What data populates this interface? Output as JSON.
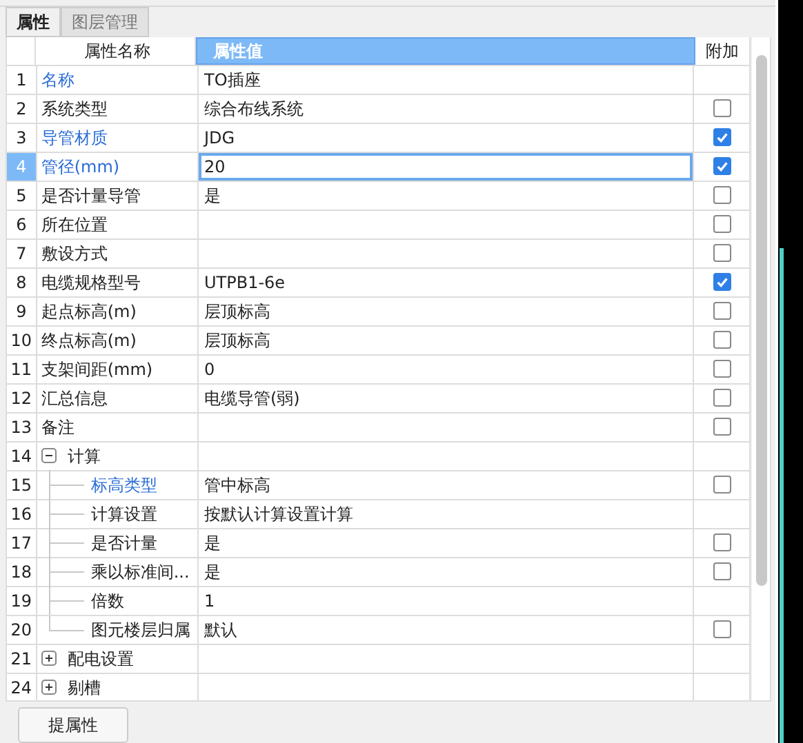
{
  "tabs": [
    {
      "label": "属性",
      "selected": true
    },
    {
      "label": "图层管理",
      "selected": false
    }
  ],
  "columns": {
    "name": "属性名称",
    "value": "属性值",
    "extra": "附加"
  },
  "rows": [
    {
      "num": "1",
      "name": "名称",
      "value": "TO插座",
      "emphasized": true,
      "selected": false
    },
    {
      "num": "2",
      "name": "系统类型",
      "value": "综合布线系统",
      "emphasized": false,
      "selected": false,
      "checked": false
    },
    {
      "num": "3",
      "name": "导管材质",
      "value": "JDG",
      "emphasized": true,
      "selected": false,
      "checked": true
    },
    {
      "num": "4",
      "name": "管径(mm)",
      "value": "20",
      "emphasized": true,
      "selected": true,
      "checked": true
    },
    {
      "num": "5",
      "name": "是否计量导管",
      "value": "是",
      "emphasized": false,
      "selected": false,
      "checked": false
    },
    {
      "num": "6",
      "name": "所在位置",
      "value": "",
      "emphasized": false,
      "selected": false,
      "checked": false
    },
    {
      "num": "7",
      "name": "敷设方式",
      "value": "",
      "emphasized": false,
      "selected": false,
      "checked": false
    },
    {
      "num": "8",
      "name": "电缆规格型号",
      "value": "UTPB1-6e",
      "emphasized": false,
      "selected": false,
      "checked": true
    },
    {
      "num": "9",
      "name": "起点标高(m)",
      "value": "层顶标高",
      "emphasized": false,
      "selected": false,
      "checked": false
    },
    {
      "num": "10",
      "name": "终点标高(m)",
      "value": "层顶标高",
      "emphasized": false,
      "selected": false,
      "checked": false
    },
    {
      "num": "11",
      "name": "支架间距(mm)",
      "value": "0",
      "emphasized": false,
      "selected": false,
      "checked": false
    },
    {
      "num": "12",
      "name": "汇总信息",
      "value": "电缆导管(弱)",
      "emphasized": false,
      "selected": false,
      "checked": false
    },
    {
      "num": "13",
      "name": "备注",
      "value": "",
      "emphasized": false,
      "selected": false,
      "checked": false
    },
    {
      "num": "14",
      "name": "计算",
      "value": "",
      "emphasized": false,
      "selected": false,
      "expanded": true,
      "children": [
        {
          "num": "15",
          "name": "标高类型",
          "value": "管中标高",
          "emphasized": true,
          "selected": false,
          "checked": false
        },
        {
          "num": "16",
          "name": "计算设置",
          "value": "按默认计算设置计算",
          "emphasized": false,
          "selected": false
        },
        {
          "num": "17",
          "name": "是否计量",
          "value": "是",
          "emphasized": false,
          "selected": false,
          "checked": false
        },
        {
          "num": "18",
          "name": "乘以标准间...",
          "value": "是",
          "emphasized": false,
          "selected": false,
          "checked": false
        },
        {
          "num": "19",
          "name": "倍数",
          "value": "1",
          "emphasized": false,
          "selected": false
        },
        {
          "num": "20",
          "name": "图元楼层归属",
          "value": "默认",
          "emphasized": false,
          "selected": false,
          "checked": false
        }
      ]
    },
    {
      "num": "21",
      "name": "配电设置",
      "value": "",
      "emphasized": false,
      "selected": false,
      "expanded": false
    },
    {
      "num": "24",
      "name": "剔槽",
      "value": "",
      "emphasized": false,
      "selected": false,
      "expanded": false
    }
  ],
  "bottom_button": "提属性"
}
